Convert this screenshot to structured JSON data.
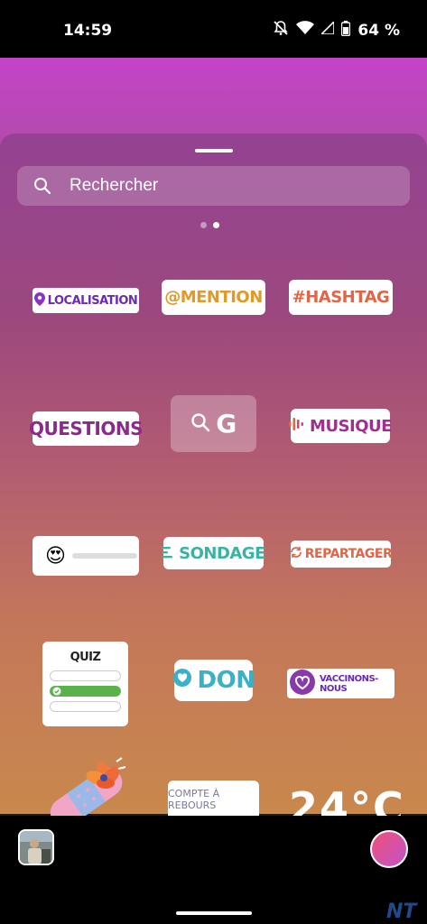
{
  "status_bar": {
    "time": "14:59",
    "battery": "64 %"
  },
  "search": {
    "placeholder": "Rechercher"
  },
  "page_dots": {
    "count": 2,
    "active_index": 1
  },
  "stickers": {
    "location": "LOCALISATION",
    "mention": "@MENTION",
    "hashtag": "#HASHTAG",
    "questions": "QUESTIONS",
    "gif": "G",
    "music": "MUSIQUE",
    "slider_emoji": "😍",
    "poll": "SONDAGE",
    "repost": "REPARTAGER",
    "quiz": "QUIZ",
    "donation": "DON",
    "vaccine": "VACCINONS-NOUS",
    "countdown": "COMPTE À REBOURS",
    "temperature": "24°C"
  },
  "watermark": "NT",
  "colors": {
    "capture_gradient_start": "#f0507a",
    "capture_gradient_end": "#c054c8",
    "quiz_correct": "#5ab34a"
  }
}
